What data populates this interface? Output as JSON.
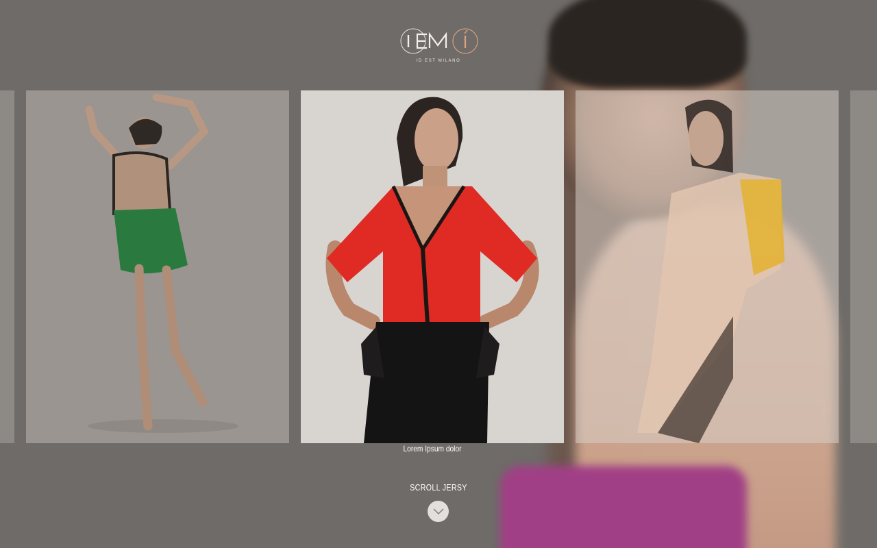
{
  "brand": {
    "tagline": "ID EST MILANO",
    "colors": {
      "accent": "#d9a07d",
      "ink": "#ffffff"
    }
  },
  "gallery": {
    "active_caption": "Lorem Ipsum dolor"
  },
  "scroll": {
    "label": "SCROLL JERSY",
    "icon": "chevron-down-icon"
  }
}
